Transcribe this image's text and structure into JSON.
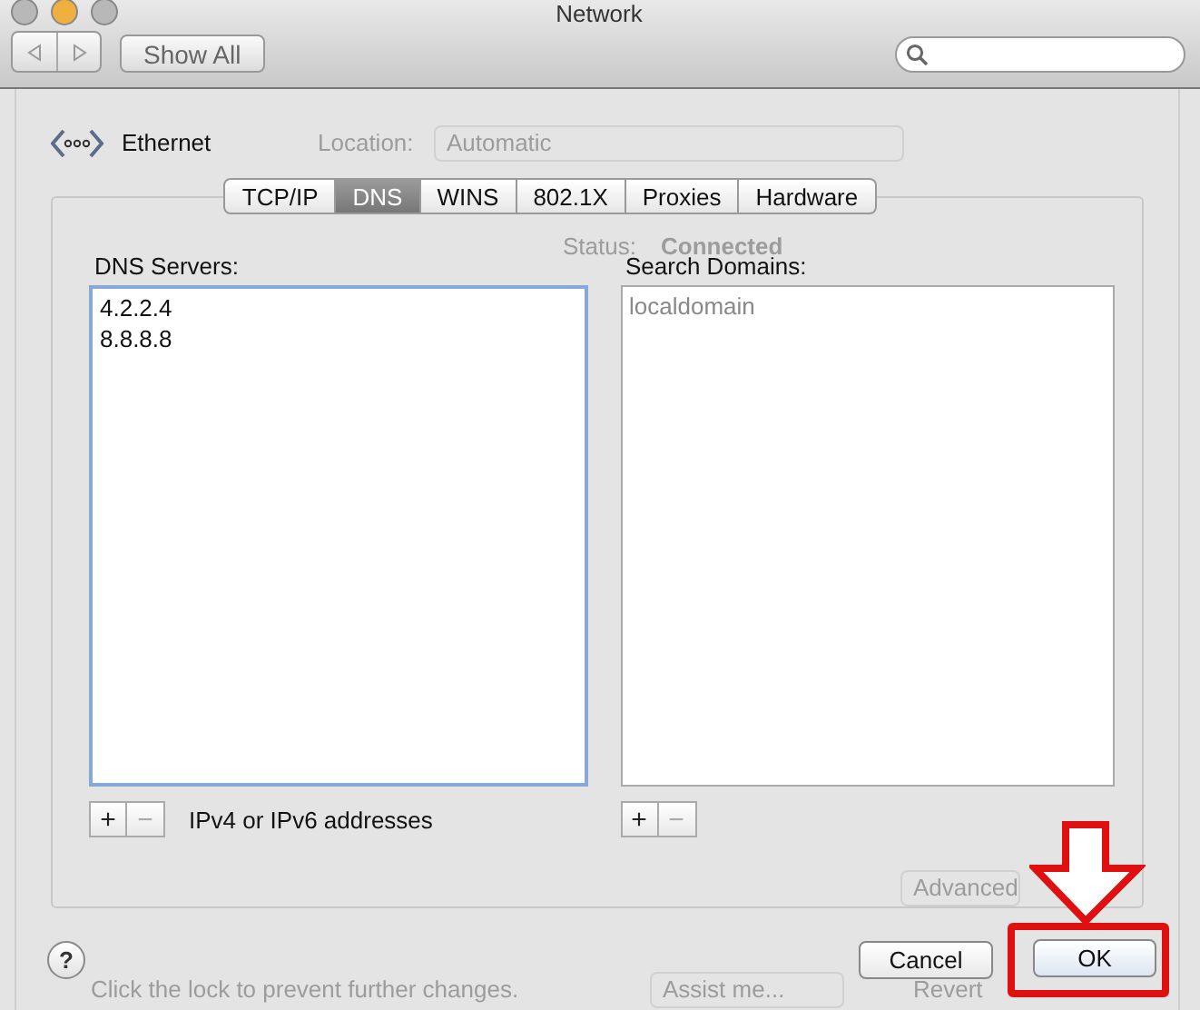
{
  "window": {
    "title": "Network"
  },
  "toolbar": {
    "show_all": "Show All"
  },
  "background": {
    "location_label": "Location:",
    "location_value": "Automatic",
    "status_label": "Status:",
    "status_value": "Connected",
    "advanced_button": "Advanced",
    "lock_text": "Click the lock to prevent further changes.",
    "assist_button": "Assist me...",
    "revert_button": "Revert"
  },
  "sheet": {
    "service": "Ethernet",
    "tabs": [
      {
        "label": "TCP/IP",
        "selected": false
      },
      {
        "label": "DNS",
        "selected": true
      },
      {
        "label": "WINS",
        "selected": false
      },
      {
        "label": "802.1X",
        "selected": false
      },
      {
        "label": "Proxies",
        "selected": false
      },
      {
        "label": "Hardware",
        "selected": false
      }
    ],
    "lists": [
      {
        "label": "DNS Servers:",
        "focused": true,
        "entries": [
          {
            "text": "4.2.2.4",
            "greyed": false
          },
          {
            "text": "8.8.8.8",
            "greyed": false
          }
        ],
        "controls": [
          {
            "label": "+",
            "disabled": false
          },
          {
            "label": "−",
            "disabled": true
          }
        ],
        "hint": "IPv4 or IPv6 addresses"
      },
      {
        "label": "Search Domains:",
        "focused": false,
        "entries": [
          {
            "text": "localdomain",
            "greyed": true
          }
        ],
        "controls": [
          {
            "label": "+",
            "disabled": false
          },
          {
            "label": "−",
            "disabled": true
          }
        ]
      }
    ],
    "help": "?",
    "buttons": [
      {
        "label": "Cancel",
        "default": false
      },
      {
        "label": "OK",
        "default": true
      }
    ]
  }
}
